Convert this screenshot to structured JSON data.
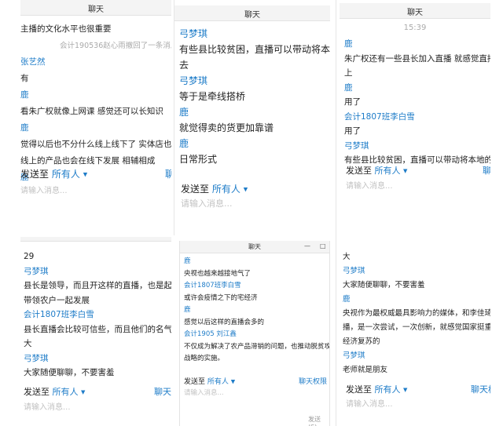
{
  "panel1": {
    "title": "聊天",
    "messages": [
      {
        "kind": "text",
        "value": "主播的文化水平也很重要"
      },
      {
        "kind": "gray",
        "value": "会计190536赵心雨撤回了一条消息"
      },
      {
        "kind": "sender",
        "value": "张艺然"
      },
      {
        "kind": "text",
        "value": "有"
      },
      {
        "kind": "sender",
        "value": "鹿"
      },
      {
        "kind": "text",
        "value": "看朱广权就像上网课  感觉还可以长知识"
      },
      {
        "kind": "sender",
        "value": "鹿"
      },
      {
        "kind": "text",
        "value": "觉得以后也不分什么线上线下了  实体店也"
      },
      {
        "kind": "text",
        "value": "线上的产品也会在线下发展  相辅相成"
      },
      {
        "kind": "sender",
        "value": "鹿"
      }
    ],
    "send_label": "发送至",
    "send_target": "所有人",
    "perm_label": "聊天权限",
    "placeholder": "请输入消息..."
  },
  "panel2": {
    "title": "聊天",
    "messages": [
      {
        "kind": "sender",
        "value": "弓梦琪"
      },
      {
        "kind": "text",
        "value": "有些县比较贫困，直播可以带动将本地的东西卖出"
      },
      {
        "kind": "text",
        "value": "去"
      },
      {
        "kind": "sender",
        "value": "弓梦琪"
      },
      {
        "kind": "text",
        "value": "等于是牵线搭桥"
      },
      {
        "kind": "sender",
        "value": "鹿"
      },
      {
        "kind": "text",
        "value": "就觉得卖的货更加靠谱"
      },
      {
        "kind": "sender",
        "value": "鹿"
      },
      {
        "kind": "text",
        "value": "日常形式"
      }
    ],
    "send_label": "发送至",
    "send_target": "所有人",
    "placeholder": "请输入消息..."
  },
  "panel3": {
    "title": "聊天",
    "time": "15:39",
    "messages": [
      {
        "kind": "sender",
        "value": "鹿"
      },
      {
        "kind": "text",
        "value": "朱广权还有一些县长加入直播  就感觉直播更加靠谱"
      },
      {
        "kind": "text",
        "value": "上"
      },
      {
        "kind": "sender",
        "value": "鹿"
      },
      {
        "kind": "text",
        "value": "用了"
      },
      {
        "kind": "sender",
        "value": "会计1807班李白雪"
      },
      {
        "kind": "text",
        "value": "用了"
      },
      {
        "kind": "sender",
        "value": "弓梦琪"
      },
      {
        "kind": "text",
        "value": "有些县比较贫困，直播可以带动将本地的农产品卖出去"
      }
    ],
    "send_label": "发送至",
    "send_target": "所有人",
    "perm_label": "聊天权限",
    "placeholder": "请输入消息..."
  },
  "panel4": {
    "messages": [
      {
        "kind": "text",
        "value": "29"
      },
      {
        "kind": "sender",
        "value": "弓梦琪"
      },
      {
        "kind": "text",
        "value": "县长是领导，而且开这样的直播，也是起带头作用"
      },
      {
        "kind": "text",
        "value": "带领农户一起发展"
      },
      {
        "kind": "sender",
        "value": "会计1807班李白雪"
      },
      {
        "kind": "text",
        "value": "县长直播会比较可信些，而且他们的名气会比较"
      },
      {
        "kind": "text",
        "value": "大"
      },
      {
        "kind": "sender",
        "value": "弓梦琪"
      },
      {
        "kind": "text",
        "value": "大家随便聊聊，不要害羞"
      }
    ],
    "send_label": "发送至",
    "send_target": "所有人",
    "perm_label": "聊天权限",
    "placeholder": "请输入消息..."
  },
  "panel5": {
    "title": "聊天",
    "minimize": "—",
    "maximize": "□",
    "messages": [
      {
        "kind": "sender",
        "value": "鹿"
      },
      {
        "kind": "text",
        "value": "央视也越来越接地气了"
      },
      {
        "kind": "sender",
        "value": "会计1807班李白雪"
      },
      {
        "kind": "text",
        "value": "或许会疫情之下的宅经济"
      },
      {
        "kind": "sender",
        "value": "鹿"
      },
      {
        "kind": "text",
        "value": "感觉以后这样的直播会多的"
      },
      {
        "kind": "sender",
        "value": "会计1905 刘江鑫"
      },
      {
        "kind": "text",
        "value": "不仅成为解决了农产品滞销的问题，也推动脱贫攻坚"
      },
      {
        "kind": "text",
        "value": "战略的实施。"
      }
    ],
    "send_label": "发送至",
    "send_target": "所有人",
    "perm_label": "聊天权限",
    "placeholder": "请输入消息...",
    "send_button": "发送(S)"
  },
  "panel6": {
    "messages": [
      {
        "kind": "text",
        "value": "大"
      },
      {
        "kind": "sender",
        "value": "弓梦琪"
      },
      {
        "kind": "text",
        "value": "大家随便聊聊，不要害羞"
      },
      {
        "kind": "sender",
        "value": "鹿"
      },
      {
        "kind": "text",
        "value": "央视作为最权威最具影响力的媒体，和李佳琦一起直"
      },
      {
        "kind": "text",
        "value": "播，是一次尝试，一次创新，就感觉国家挺重视湖北"
      },
      {
        "kind": "text",
        "value": "经济复苏的"
      },
      {
        "kind": "sender",
        "value": "弓梦琪"
      },
      {
        "kind": "text",
        "value": "老师就是朋友"
      }
    ],
    "send_label": "发送至",
    "send_target": "所有人",
    "perm_label": "聊天权限",
    "placeholder": "请输入消息..."
  }
}
